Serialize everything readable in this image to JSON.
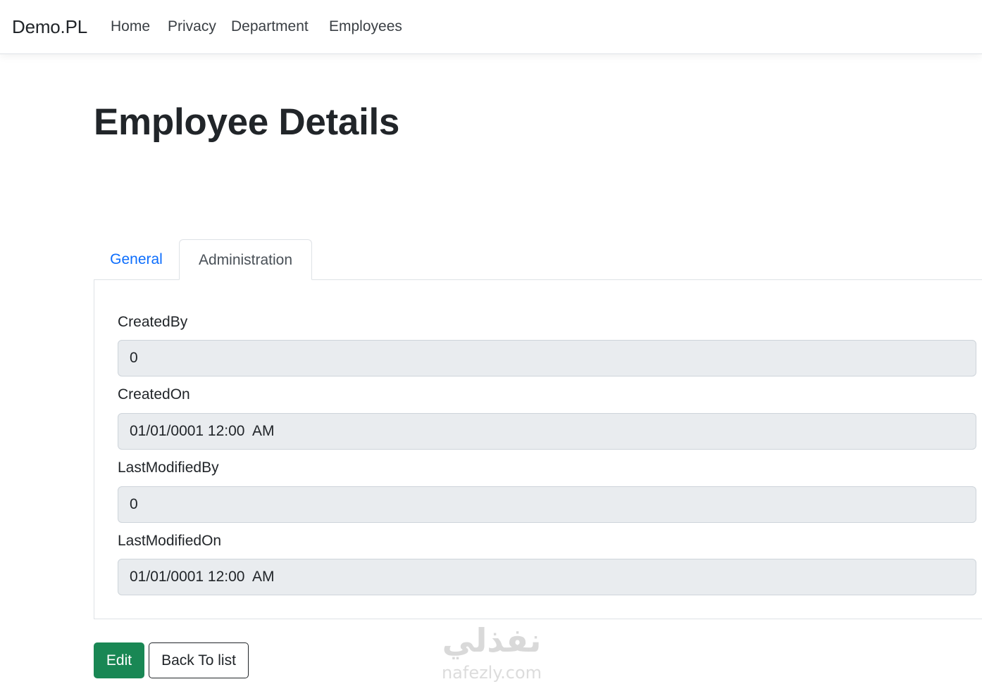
{
  "navbar": {
    "brand": "Demo.PL",
    "links": [
      "Home",
      "Privacy",
      "Department",
      "Employees"
    ]
  },
  "page": {
    "title": "Employee Details"
  },
  "tabs": [
    {
      "label": "General",
      "active": false
    },
    {
      "label": "Administration",
      "active": true
    }
  ],
  "fields": [
    {
      "label": "CreatedBy",
      "value": "0"
    },
    {
      "label": "CreatedOn",
      "value": "01/01/0001 12:00  AM"
    },
    {
      "label": "LastModifiedBy",
      "value": "0"
    },
    {
      "label": "LastModifiedOn",
      "value": "01/01/0001 12:00  AM"
    }
  ],
  "actions": {
    "edit_label": "Edit",
    "back_label": "Back To list"
  },
  "watermark": {
    "arabic": "نفذلي",
    "latin": "nafezly.com"
  },
  "colors": {
    "link": "#0d6efd",
    "edit_button": "#198754",
    "readonly_input": "#e9ecef"
  }
}
